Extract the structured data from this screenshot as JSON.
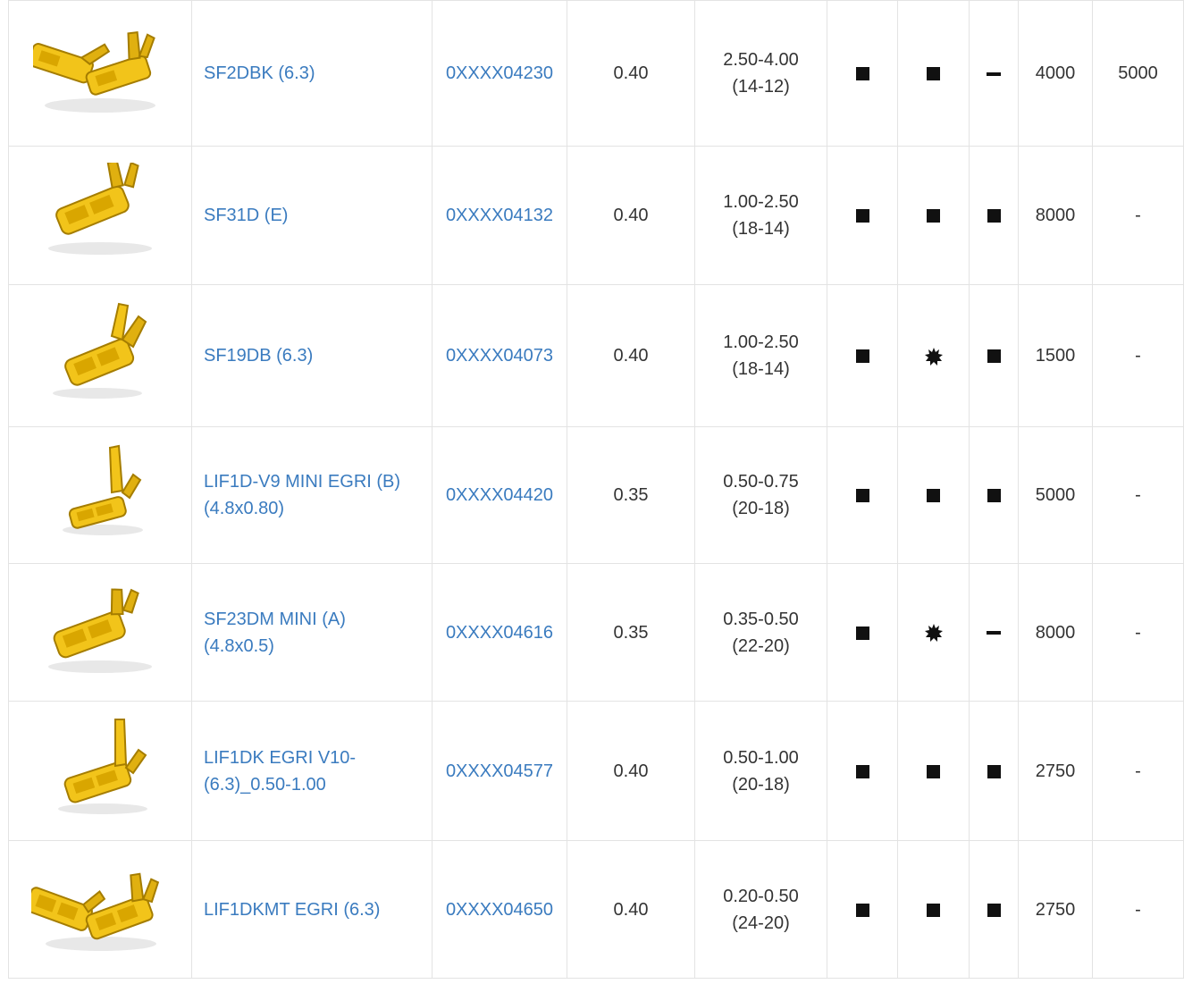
{
  "colors": {
    "link": "#3a7bbf",
    "text": "#333333",
    "border": "#e3e3e3",
    "terminal_fill": "#f2c41a",
    "terminal_dark": "#b88c00"
  },
  "rows": [
    {
      "image_icon": "double-terminal-icon",
      "name": "SF2DBK (6.3)",
      "code": "0XXXX04230",
      "thickness": "0.40",
      "range_a": "2.50-4.00",
      "range_b": "(14-12)",
      "c1": "square",
      "c2": "square",
      "c3": "dash",
      "qty_a": "4000",
      "qty_b": "5000"
    },
    {
      "image_icon": "terminal-icon",
      "name": "SF31D (E)",
      "code": "0XXXX04132",
      "thickness": "0.40",
      "range_a": "1.00-2.50",
      "range_b": "(18-14)",
      "c1": "square",
      "c2": "square",
      "c3": "square",
      "qty_a": "8000",
      "qty_b": "-"
    },
    {
      "image_icon": "terminal-icon",
      "name": "SF19DB (6.3)",
      "code": "0XXXX04073",
      "thickness": "0.40",
      "range_a": "1.00-2.50",
      "range_b": "(18-14)",
      "c1": "square",
      "c2": "star",
      "c3": "square",
      "qty_a": "1500",
      "qty_b": "-"
    },
    {
      "image_icon": "terminal-icon",
      "name_line1": "LIF1D-V9 MINI EGRI (B)",
      "name_line2": "(4.8x0.80)",
      "code": "0XXXX04420",
      "thickness": "0.35",
      "range_a": "0.50-0.75",
      "range_b": "(20-18)",
      "c1": "square",
      "c2": "square",
      "c3": "square",
      "qty_a": "5000",
      "qty_b": "-"
    },
    {
      "image_icon": "terminal-icon",
      "name_line1": "SF23DM MINI (A)",
      "name_line2": "(4.8x0.5)",
      "code": "0XXXX04616",
      "thickness": "0.35",
      "range_a": "0.35-0.50",
      "range_b": "(22-20)",
      "c1": "square",
      "c2": "star",
      "c3": "dash",
      "qty_a": "8000",
      "qty_b": "-"
    },
    {
      "image_icon": "terminal-icon",
      "name_line1": "LIF1DK EGRI V10-",
      "name_line2": "(6.3)_0.50-1.00",
      "code": "0XXXX04577",
      "thickness": "0.40",
      "range_a": "0.50-1.00",
      "range_b": "(20-18)",
      "c1": "square",
      "c2": "square",
      "c3": "square",
      "qty_a": "2750",
      "qty_b": "-"
    },
    {
      "image_icon": "double-terminal-icon",
      "name": "LIF1DKMT EGRI (6.3)",
      "code": "0XXXX04650",
      "thickness": "0.40",
      "range_a": "0.20-0.50",
      "range_b": "(24-20)",
      "c1": "square",
      "c2": "square",
      "c3": "square",
      "qty_a": "2750",
      "qty_b": "-"
    }
  ]
}
